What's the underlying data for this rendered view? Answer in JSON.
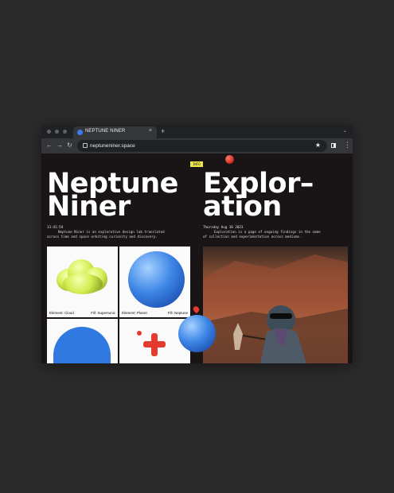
{
  "browser": {
    "tab_title": "NEPTUNE NINER",
    "new_tab_icon": "+",
    "close_icon": "×",
    "menu_chevron": "⌄",
    "url": "neptuneniner.space",
    "bookmark_star": "★",
    "menu_icon": "⋮"
  },
  "left": {
    "title_line1": "Neptune",
    "title_line2": "Niner",
    "time": "13:41:54",
    "description_line1": "Neptune Niner is an explorative design lab translated",
    "description_line2": "across time and space orbiting curiosity and discovery."
  },
  "right": {
    "badge": "INFO",
    "title_line1": "Explor–",
    "title_line2": "ation",
    "date": "Thursday Aug 10 2023",
    "description_line1": "Exploration is a page of ongoing findings in the name",
    "description_line2": "of collection and experimentation across mediums."
  },
  "cards": [
    {
      "element": "Element: Cloud",
      "fill": "Fill: Supersonic"
    },
    {
      "element": "Element: Planet",
      "fill": "Fill: Neptune"
    }
  ],
  "colors": {
    "page_bg": "#191516",
    "badge_bg": "#f1e84c",
    "accent_blue": "#3d86e6",
    "accent_red": "#e33b2e",
    "cloud_yellow": "#d2ee52"
  }
}
